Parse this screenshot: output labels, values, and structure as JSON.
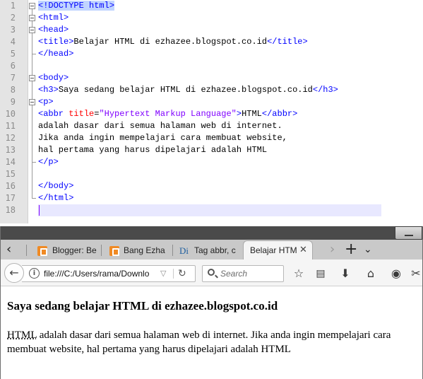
{
  "editor": {
    "lines": [
      {
        "num": "1",
        "fold": "box-start",
        "tokens": [
          [
            "doctype",
            "<!DOCTYPE html>"
          ]
        ]
      },
      {
        "num": "2",
        "fold": "box",
        "tokens": [
          [
            "tag",
            "<html>"
          ]
        ]
      },
      {
        "num": "3",
        "fold": "box",
        "tokens": [
          [
            "tag",
            "<head>"
          ]
        ]
      },
      {
        "num": "4",
        "fold": "line",
        "tokens": [
          [
            "tag",
            "<title>"
          ],
          [
            "text",
            "Belajar HTML di ezhazee.blogspot.co.id"
          ],
          [
            "tag",
            "</title>"
          ]
        ]
      },
      {
        "num": "5",
        "fold": "end",
        "tokens": [
          [
            "tag",
            "</head>"
          ]
        ]
      },
      {
        "num": "6",
        "fold": "line",
        "tokens": []
      },
      {
        "num": "7",
        "fold": "box",
        "tokens": [
          [
            "tag",
            "<body>"
          ]
        ]
      },
      {
        "num": "8",
        "fold": "line",
        "tokens": [
          [
            "tag",
            "<h3>"
          ],
          [
            "text",
            "Saya sedang belajar HTML di ezhazee.blogspot.co.id"
          ],
          [
            "tag",
            "</h3>"
          ]
        ]
      },
      {
        "num": "9",
        "fold": "box",
        "tokens": [
          [
            "tag",
            "<p>"
          ]
        ]
      },
      {
        "num": "10",
        "fold": "line",
        "tokens": [
          [
            "tag",
            "<abbr "
          ],
          [
            "attr",
            "title"
          ],
          [
            "text",
            "="
          ],
          [
            "val",
            "\"Hypertext Markup Language\""
          ],
          [
            "tag",
            ">"
          ],
          [
            "text",
            "HTML"
          ],
          [
            "tag",
            "</abbr>"
          ]
        ]
      },
      {
        "num": "11",
        "fold": "line",
        "tokens": [
          [
            "text",
            "adalah dasar dari semua halaman web di internet."
          ]
        ]
      },
      {
        "num": "12",
        "fold": "line",
        "tokens": [
          [
            "text",
            "Jika anda ingin mempelajari cara membuat website,"
          ]
        ]
      },
      {
        "num": "13",
        "fold": "line",
        "tokens": [
          [
            "text",
            "hal pertama yang harus dipelajari adalah HTML"
          ]
        ]
      },
      {
        "num": "14",
        "fold": "end",
        "tokens": [
          [
            "tag",
            "</p>"
          ]
        ]
      },
      {
        "num": "15",
        "fold": "line",
        "tokens": []
      },
      {
        "num": "16",
        "fold": "line",
        "tokens": [
          [
            "tag",
            "</body>"
          ]
        ]
      },
      {
        "num": "17",
        "fold": "end",
        "tokens": [
          [
            "tag",
            "</html>"
          ]
        ]
      },
      {
        "num": "18",
        "fold": "none",
        "tokens": [],
        "active": true
      }
    ]
  },
  "browser": {
    "tabs": [
      {
        "label": "Blogger: Be",
        "icon": "blogger-icon"
      },
      {
        "label": "Bang Ezha",
        "icon": "blogger-icon"
      },
      {
        "label": "Tag abbr, c",
        "icon": "di-icon"
      }
    ],
    "active_tab": {
      "label": "Belajar HTM",
      "close": "✕"
    },
    "url": "file:///C:/Users/rama/Downlo",
    "search_placeholder": "Search",
    "favicon_di": "Di"
  },
  "page": {
    "heading": "Saya sedang belajar HTML di ezhazee.blogspot.co.id",
    "abbr_text": "HTML",
    "abbr_title": "Hypertext Markup Language",
    "paragraph_rest": " adalah dasar dari semua halaman web di internet. Jika anda ingin mempelajari cara membuat website, hal pertama yang harus dipelajari adalah HTML"
  },
  "colors": {
    "tag": "#0000ff",
    "attr": "#ff0000",
    "value": "#8000ff",
    "titlebar": "#4a4a4a",
    "active_line": "#e8e8ff"
  }
}
